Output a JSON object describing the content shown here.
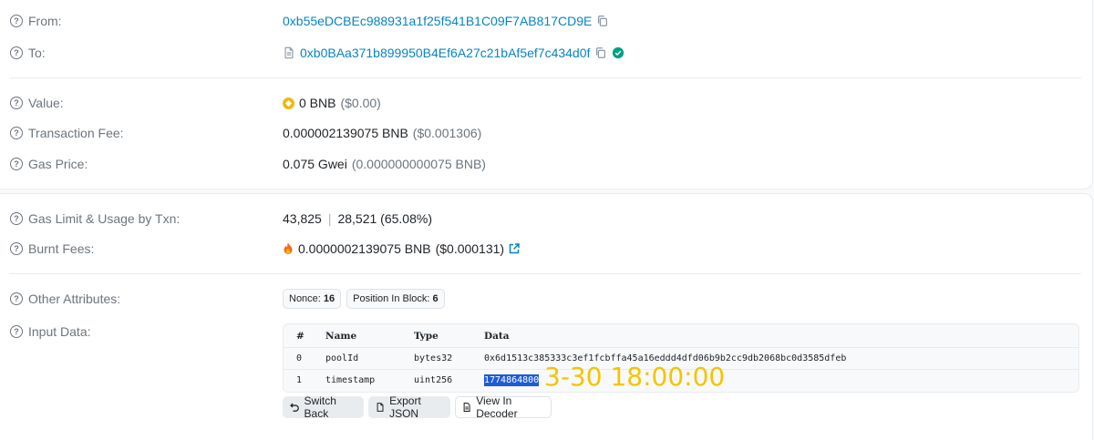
{
  "from": {
    "label": "From:",
    "address": "0xb55eDCBEc988931a1f25f541B1C09F7AB817CD9E"
  },
  "to": {
    "label": "To:",
    "address": "0xb0BAa371b899950B4Ef6A27c21bAf5ef7c434d0f"
  },
  "value": {
    "label": "Value:",
    "amount": "0 BNB",
    "usd": "($0.00)"
  },
  "transaction_fee": {
    "label": "Transaction Fee:",
    "amount": "0.000002139075 BNB",
    "usd": "($0.001306)"
  },
  "gas_price": {
    "label": "Gas Price:",
    "amount": "0.075 Gwei",
    "detail": "(0.000000000075 BNB)"
  },
  "gas_limit": {
    "label": "Gas Limit & Usage by Txn:",
    "limit": "43,825",
    "separator": "|",
    "usage": "28,521 (65.08%)"
  },
  "burnt_fees": {
    "label": "Burnt Fees:",
    "amount": "0.0000002139075 BNB",
    "usd": "($0.000131)"
  },
  "other_attributes": {
    "label": "Other Attributes:",
    "nonce_label": "Nonce:",
    "nonce_value": "16",
    "position_label": "Position In Block:",
    "position_value": "6"
  },
  "input_data": {
    "label": "Input Data:",
    "columns": [
      "#",
      "Name",
      "Type",
      "Data"
    ],
    "rows": [
      {
        "index": "0",
        "name": "poolId",
        "type": "bytes32",
        "data": "0x6d1513c385333c3ef1fcbffa45a16eddd4dfd06b9b2cc9db2068bc0d3585dfeb"
      },
      {
        "index": "1",
        "name": "timestamp",
        "type": "uint256",
        "data": "1774864800"
      }
    ],
    "annotation": "3-30 18:00:00",
    "buttons": {
      "switch_back": "Switch Back",
      "export_json": "Export JSON",
      "view_in_decoder": "View In Decoder"
    }
  },
  "colors": {
    "link": "#0784c3",
    "muted": "#6c757d",
    "verified": "#00a186",
    "bnb": "#f0b90b",
    "highlight": "#1d5bd8",
    "annotation": "#f5c400"
  }
}
